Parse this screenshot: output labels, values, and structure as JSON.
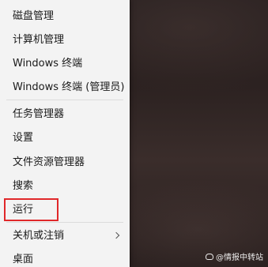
{
  "menu": {
    "items": [
      {
        "label": "磁盘管理"
      },
      {
        "label": "计算机管理"
      },
      {
        "label": "Windows 终端"
      },
      {
        "label": "Windows 终端 (管理员)"
      },
      {
        "label": "任务管理器"
      },
      {
        "label": "设置"
      },
      {
        "label": "文件资源管理器"
      },
      {
        "label": "搜索"
      },
      {
        "label": "运行"
      },
      {
        "label": "关机或注销"
      },
      {
        "label": "桌面"
      }
    ]
  },
  "highlight_color": "#e0282a",
  "watermark": {
    "icon": "weibo-like-icon",
    "text": "@情报中转站"
  }
}
